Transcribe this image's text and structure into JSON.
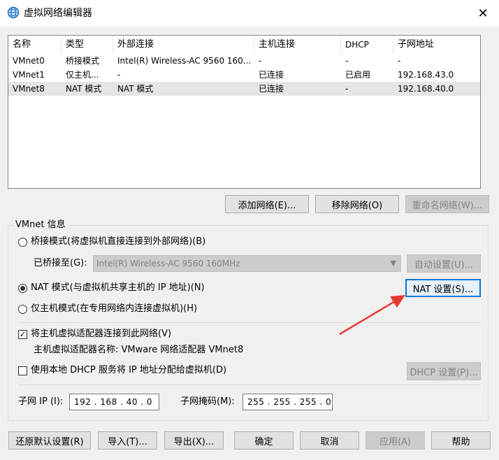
{
  "window": {
    "title": "虚拟网络编辑器",
    "close_glyph": "✕"
  },
  "table": {
    "headers": [
      "名称",
      "类型",
      "外部连接",
      "主机连接",
      "DHCP",
      "子网地址"
    ],
    "rows": [
      [
        "VMnet0",
        "桥接模式",
        "Intel(R) Wireless-AC 9560 160...",
        "-",
        "-",
        "-"
      ],
      [
        "VMnet1",
        "仅主机...",
        "-",
        "已连接",
        "已启用",
        "192.168.43.0"
      ],
      [
        "VMnet8",
        "NAT 模式",
        "NAT 模式",
        "已连接",
        "-",
        "192.168.40.0"
      ]
    ],
    "selected_row": 2
  },
  "table_buttons": {
    "add": "添加网络(E)...",
    "remove": "移除网络(O)",
    "rename": "重命名网络(W)..."
  },
  "vmnet_info": {
    "group_label": "VMnet 信息",
    "bridged_label": "桥接模式(将虚拟机直接连接到外部网络)(B)",
    "bridged_to_label": "已桥接至(G):",
    "bridged_to_value": "Intel(R) Wireless-AC 9560 160MHz",
    "auto_settings": "自动设置(U)...",
    "nat_label": "NAT 模式(与虚拟机共享主机的 IP 地址)(N)",
    "nat_settings": "NAT 设置(S)...",
    "hostonly_label": "仅主机模式(在专用网络内连接虚拟机)(H)",
    "connect_adapter_label": "将主机虚拟适配器连接到此网络(V)",
    "adapter_name_label": "主机虚拟适配器名称: VMware 网络适配器 VMnet8",
    "dhcp_label": "使用本地 DHCP 服务将 IP 地址分配给虚拟机(D)",
    "dhcp_settings": "DHCP 设置(P)...",
    "subnet_ip_label": "子网 IP (I):",
    "subnet_ip_value": "192 . 168 . 40 . 0",
    "subnet_mask_label": "子网掩码(M):",
    "subnet_mask_value": "255 . 255 . 255 . 0"
  },
  "footer": {
    "restore": "还原默认设置(R)",
    "import": "导入(T)...",
    "export": "导出(X)...",
    "ok": "确定",
    "cancel": "取消",
    "apply": "应用(A)",
    "help": "帮助"
  },
  "colors": {
    "accent": "#0078d7",
    "annotation_arrow": "#e8392f"
  }
}
